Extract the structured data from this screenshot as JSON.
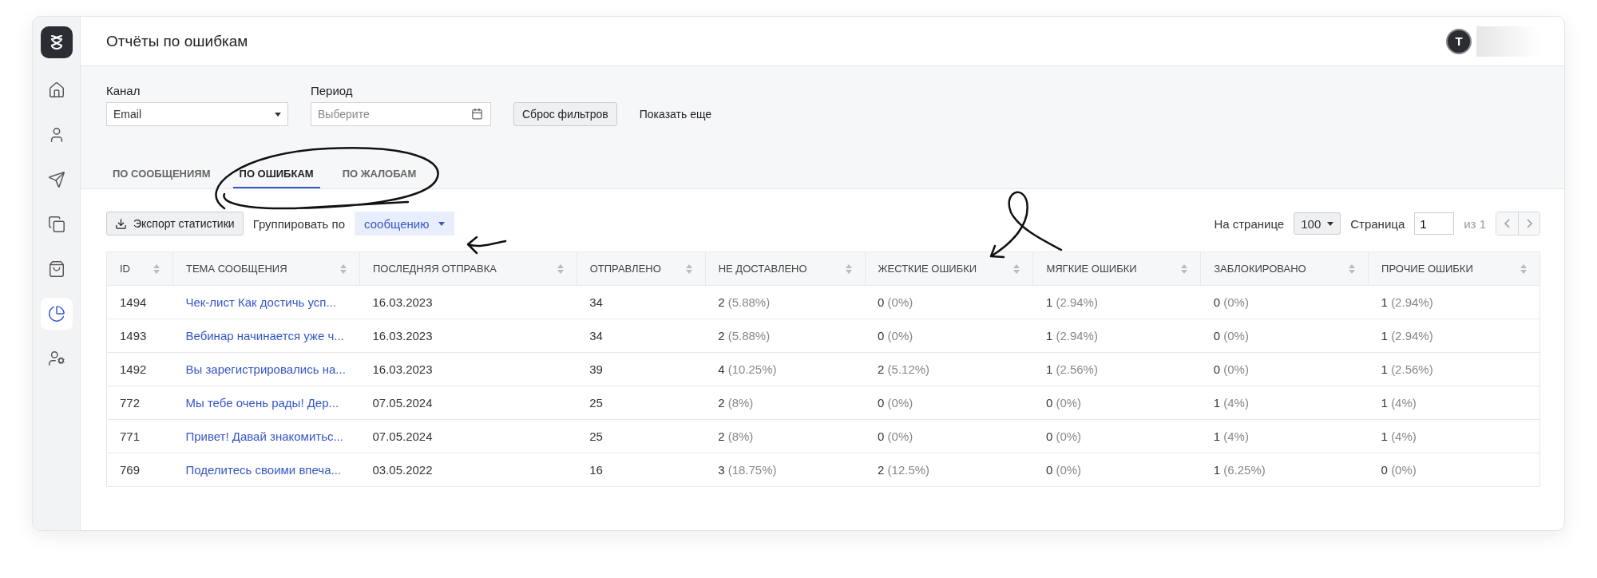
{
  "header": {
    "title": "Отчёты по ошибкам",
    "avatar": "T"
  },
  "sidebar": {
    "items": [
      {
        "selected": false
      },
      {
        "selected": false
      },
      {
        "selected": false
      },
      {
        "selected": false
      },
      {
        "selected": false
      },
      {
        "selected": true
      },
      {
        "selected": false
      }
    ]
  },
  "filters": {
    "channel": {
      "label": "Канал",
      "value": "Email"
    },
    "period": {
      "label": "Период",
      "placeholder": "Выберите"
    },
    "reset": "Сброс фильтров",
    "more": "Показать еще"
  },
  "tabs": [
    {
      "label": "ПО СООБЩЕНИЯМ",
      "selected": false
    },
    {
      "label": "ПО ОШИБКАМ",
      "selected": true
    },
    {
      "label": "ПО ЖАЛОБАМ",
      "selected": false
    }
  ],
  "toolbar": {
    "export": "Экспорт статистики",
    "group_label": "Группировать по",
    "group_value": "сообщению",
    "per_page_label": "На странице",
    "per_page": "100",
    "page_label": "Страница",
    "page": "1",
    "page_total": "из 1"
  },
  "table": {
    "columns": [
      "ID",
      "ТЕМА СООБЩЕНИЯ",
      "ПОСЛЕДНЯЯ ОТПРАВКА",
      "ОТПРАВЛЕНО",
      "НЕ ДОСТАВЛЕНО",
      "ЖЕСТКИЕ ОШИБКИ",
      "МЯГКИЕ ОШИБКИ",
      "ЗАБЛОКИРОВАНО",
      "ПРОЧИЕ ОШИБКИ"
    ],
    "rows": [
      {
        "id": "1494",
        "subject": "Чек-лист Как достичь усп...",
        "date": "16.03.2023",
        "sent": "34",
        "stats": [
          [
            "2",
            "(5.88%)"
          ],
          [
            "0",
            "(0%)"
          ],
          [
            "1",
            "(2.94%)"
          ],
          [
            "0",
            "(0%)"
          ],
          [
            "1",
            "(2.94%)"
          ]
        ]
      },
      {
        "id": "1493",
        "subject": "Вебинар начинается уже ч...",
        "date": "16.03.2023",
        "sent": "34",
        "stats": [
          [
            "2",
            "(5.88%)"
          ],
          [
            "0",
            "(0%)"
          ],
          [
            "1",
            "(2.94%)"
          ],
          [
            "0",
            "(0%)"
          ],
          [
            "1",
            "(2.94%)"
          ]
        ]
      },
      {
        "id": "1492",
        "subject": "Вы зарегистрировались на...",
        "date": "16.03.2023",
        "sent": "39",
        "stats": [
          [
            "4",
            "(10.25%)"
          ],
          [
            "2",
            "(5.12%)"
          ],
          [
            "1",
            "(2.56%)"
          ],
          [
            "0",
            "(0%)"
          ],
          [
            "1",
            "(2.56%)"
          ]
        ]
      },
      {
        "id": "772",
        "subject": "Мы тебе очень рады! Дер...",
        "date": "07.05.2024",
        "sent": "25",
        "stats": [
          [
            "2",
            "(8%)"
          ],
          [
            "0",
            "(0%)"
          ],
          [
            "0",
            "(0%)"
          ],
          [
            "1",
            "(4%)"
          ],
          [
            "1",
            "(4%)"
          ]
        ]
      },
      {
        "id": "771",
        "subject": "Привет! Давай знакомитьс...",
        "date": "07.05.2024",
        "sent": "25",
        "stats": [
          [
            "2",
            "(8%)"
          ],
          [
            "0",
            "(0%)"
          ],
          [
            "0",
            "(0%)"
          ],
          [
            "1",
            "(4%)"
          ],
          [
            "1",
            "(4%)"
          ]
        ]
      },
      {
        "id": "769",
        "subject": "Поделитесь своими впеча...",
        "date": "03.05.2022",
        "sent": "16",
        "stats": [
          [
            "3",
            "(18.75%)"
          ],
          [
            "2",
            "(12.5%)"
          ],
          [
            "0",
            "(0%)"
          ],
          [
            "1",
            "(6.25%)"
          ],
          [
            "0",
            "(0%)"
          ]
        ]
      }
    ]
  }
}
